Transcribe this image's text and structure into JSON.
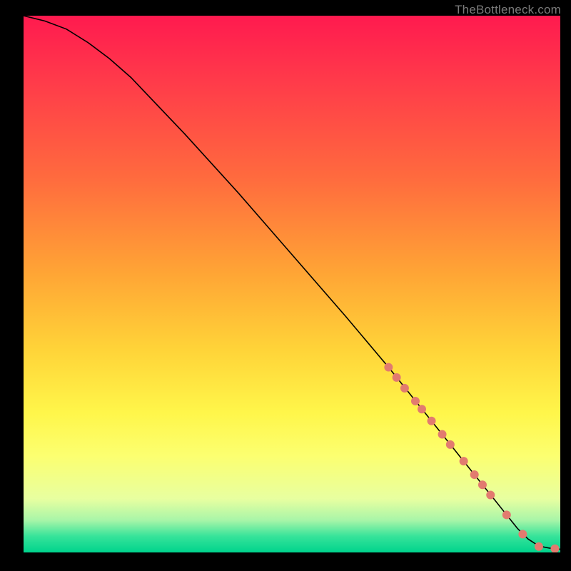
{
  "watermark": "TheBottleneck.com",
  "chart_data": {
    "type": "line",
    "title": "",
    "xlabel": "",
    "ylabel": "",
    "xlim": [
      0,
      100
    ],
    "ylim": [
      0,
      100
    ],
    "grid": false,
    "legend": false,
    "series": [
      {
        "name": "curve",
        "color": "#000000",
        "stroke_width": 1.6,
        "x": [
          0,
          4,
          8,
          12,
          16,
          20,
          30,
          40,
          50,
          60,
          68,
          72,
          76,
          80,
          84,
          88,
          90,
          92,
          94,
          96,
          98,
          100
        ],
        "y": [
          100,
          99,
          97.5,
          95,
          92,
          88.5,
          78,
          67,
          55.5,
          44,
          34.5,
          29.5,
          24.5,
          19.5,
          14.5,
          9.5,
          7,
          4.5,
          2.5,
          1.2,
          0.8,
          0.6
        ]
      }
    ],
    "markers": {
      "name": "dashed-overlay",
      "color": "#e27b6f",
      "radius": 6,
      "x": [
        68,
        69.5,
        71,
        73,
        74.2,
        76,
        78,
        79.5,
        82,
        84,
        85.5,
        87,
        90,
        93,
        96,
        99
      ],
      "y": [
        34.5,
        32.6,
        30.6,
        28.2,
        26.7,
        24.5,
        22,
        20.1,
        17,
        14.5,
        12.6,
        10.7,
        7,
        3.4,
        1.1,
        0.7
      ]
    }
  }
}
